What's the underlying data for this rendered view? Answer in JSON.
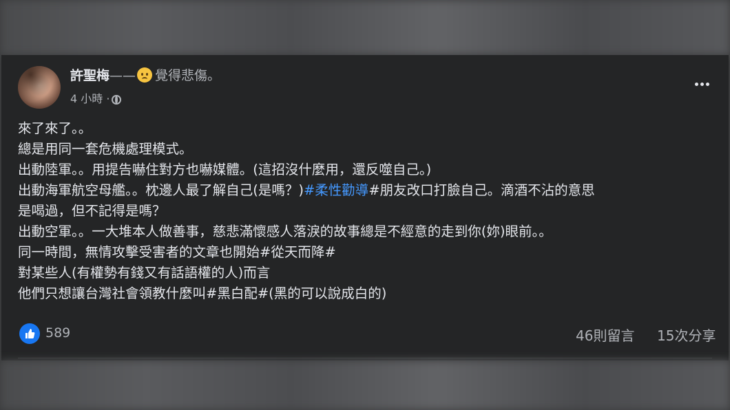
{
  "post": {
    "author": "許聖梅",
    "feeling_prefix": "——",
    "feeling_emoji": "sad-face-icon",
    "feeling_text": "覺得悲傷。",
    "timestamp": "4 小時",
    "separator": "·",
    "privacy_icon": "globe-icon",
    "body": {
      "line1": "來了來了。。",
      "line2": "總是用同一套危機處理模式。",
      "line3": "出動陸軍。。用提告嚇住對方也嚇媒體。(這招沒什麼用，還反噬自己。)",
      "line4_before": "出動海軍航空母艦。。枕邊人最了解自己(是嗎？)",
      "line4_hashtag": "#柔性勸導",
      "line4_after": "#朋友改口打臉自己。滴酒不沾的意思",
      "line5": "是喝過，但不記得是嗎？",
      "line6": "出動空軍。。一大堆本人做善事，慈悲滿懷感人落淚的故事總是不經意的走到你(妳)眼前。。",
      "line7": "同一時間，無情攻擊受害者的文章也開始#從天而降#",
      "line8": "對某些人(有權勢有錢又有話語權的人)而言",
      "line9": "他們只想讓台灣社會領教什麼叫#黑白配#(黑的可以說成白的)"
    },
    "reactions": {
      "icon": "like-icon",
      "count": "589"
    },
    "comments": "46則留言",
    "shares": "15次分享"
  },
  "colors": {
    "background": "#242526",
    "text": "#e4e6eb",
    "secondary_text": "#b0b3b8",
    "hashtag": "#4599ff",
    "like_blue": "#1877f2"
  }
}
